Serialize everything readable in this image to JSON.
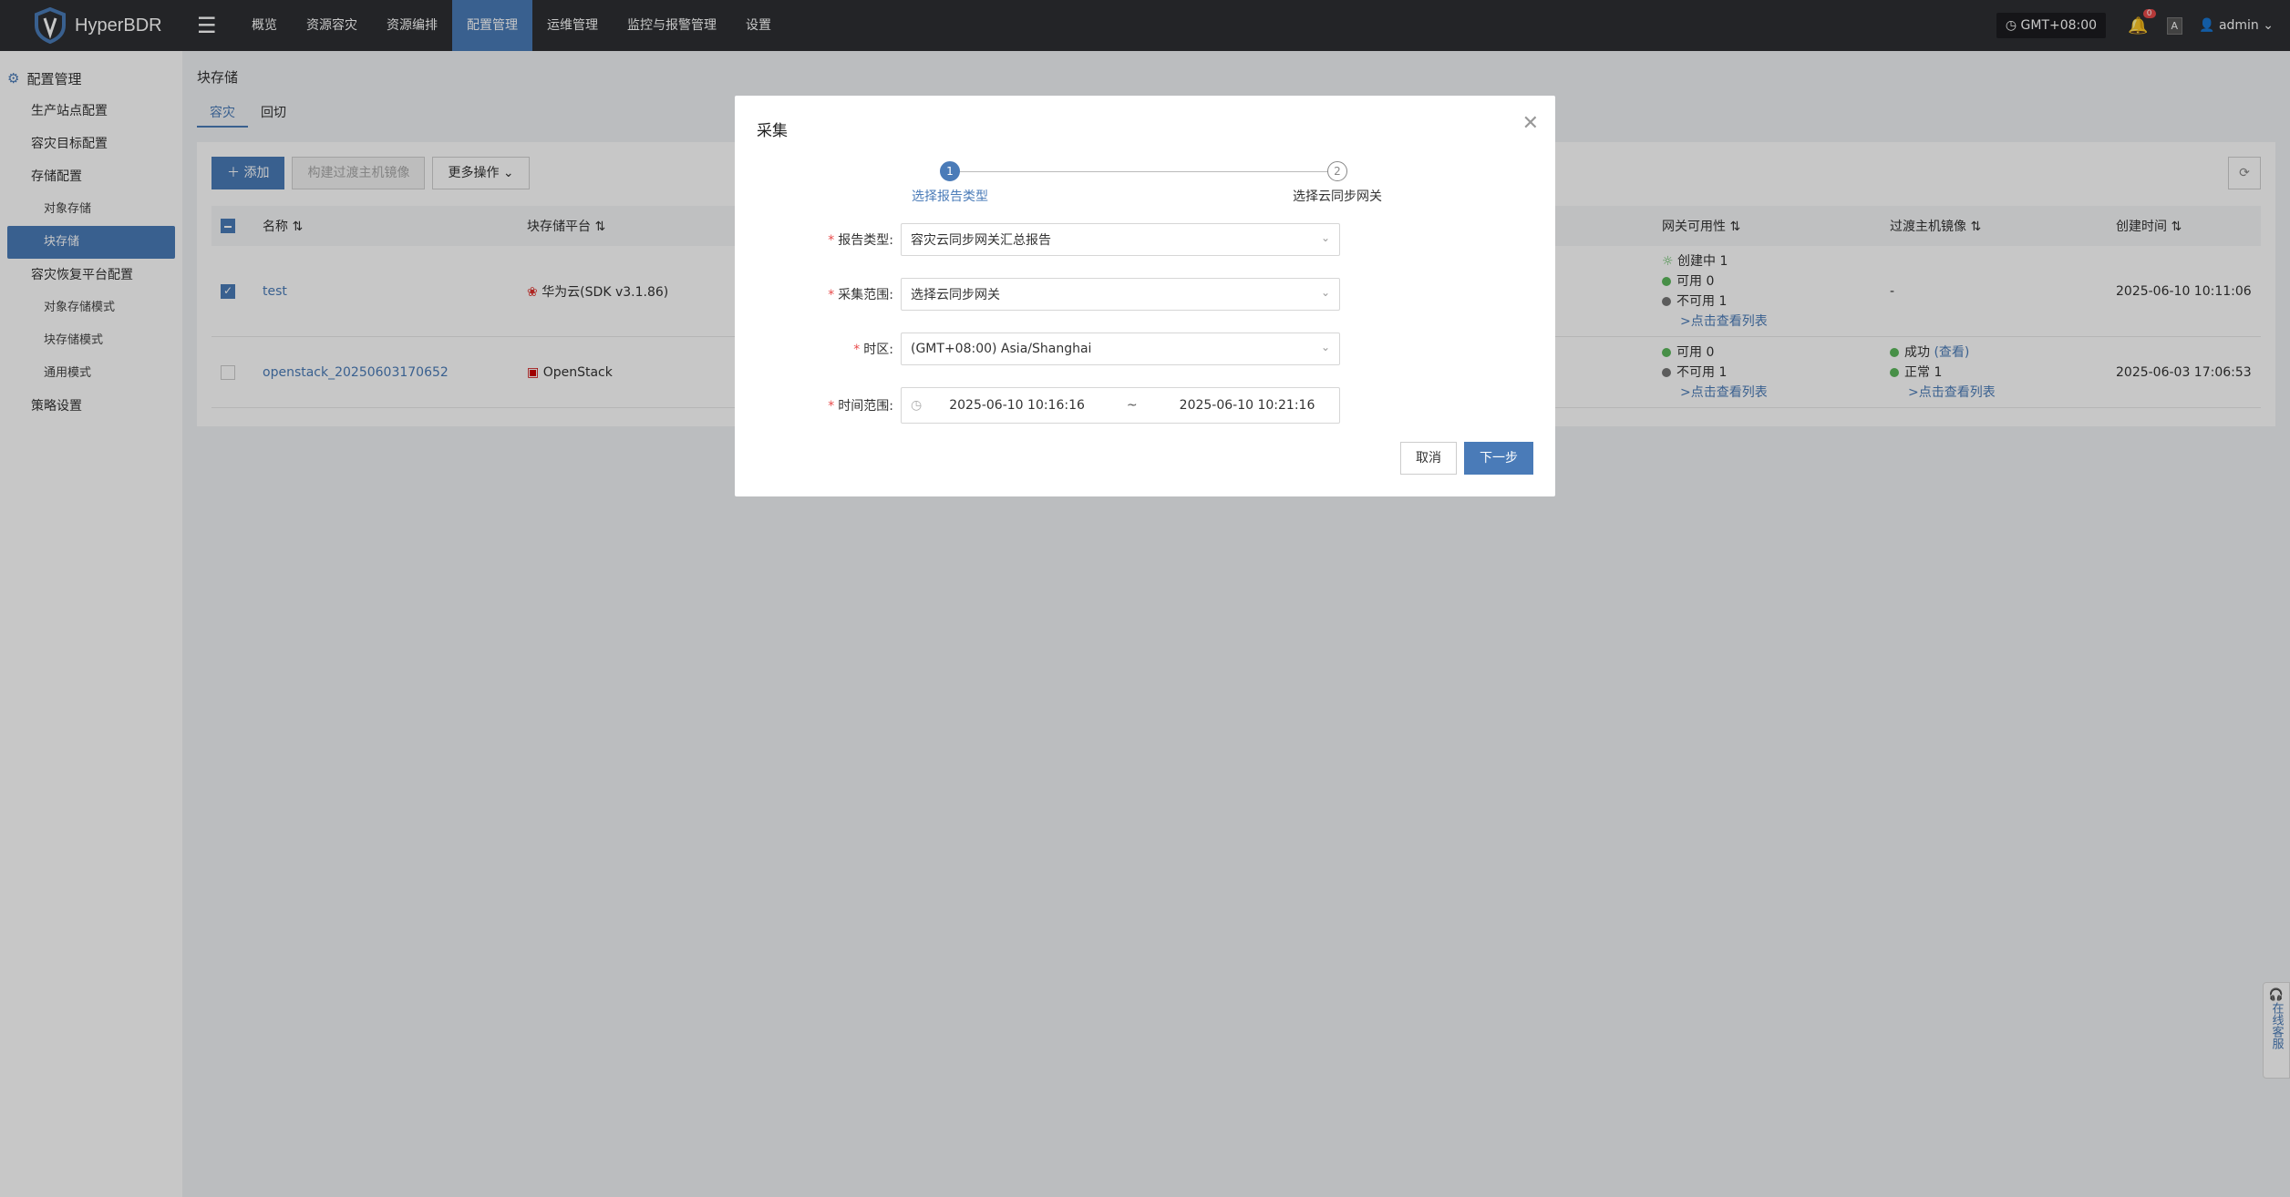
{
  "header": {
    "logo_text": "HyperBDR",
    "nav": [
      "概览",
      "资源容灾",
      "资源编排",
      "配置管理",
      "运维管理",
      "监控与报警管理",
      "设置"
    ],
    "active_nav": "配置管理",
    "timezone": "GMT+08:00",
    "notification_count": "0",
    "lang_icon": "A",
    "user": "admin"
  },
  "sidebar": {
    "title": "配置管理",
    "items": [
      "生产站点配置",
      "容灾目标配置",
      "存储配置",
      "对象存储",
      "块存储",
      "容灾恢复平台配置",
      "对象存储模式",
      "块存储模式",
      "通用模式",
      "策略设置"
    ],
    "active": "块存储"
  },
  "page": {
    "title": "块存储",
    "tabs": [
      "容灾",
      "回切"
    ],
    "toolbar": {
      "add": "添加",
      "build": "构建过渡主机镜像",
      "more": "更多操作"
    },
    "table": {
      "columns": [
        "名称",
        "块存储平台",
        "网关可用性",
        "过渡主机镜像",
        "创建时间"
      ],
      "rows": [
        {
          "name": "test",
          "platform": "华为云(SDK v3.1.86)",
          "gateway": [
            "创建中 1",
            "可用 0",
            "不可用 1"
          ],
          "gateway_link": ">点击查看列表",
          "image": "-",
          "image_link": "",
          "created": "2025-06-10 10:11:06",
          "checked": true
        },
        {
          "name": "openstack_20250603170652",
          "platform": "OpenStack",
          "gateway": [
            "可用 0",
            "不可用 1"
          ],
          "gateway_link": ">点击查看列表",
          "image": [
            "成功",
            "(查看)",
            "正常 1"
          ],
          "image_link": ">点击查看列表",
          "created": "2025-06-03 17:06:53",
          "checked": false
        }
      ]
    }
  },
  "modal": {
    "title": "采集",
    "steps": [
      {
        "num": "1",
        "label": "选择报告类型"
      },
      {
        "num": "2",
        "label": "选择云同步网关"
      }
    ],
    "fields": [
      {
        "label": "报告类型:",
        "value": "容灾云同步网关汇总报告"
      },
      {
        "label": "采集范围:",
        "value": "选择云同步网关"
      },
      {
        "label": "时区:",
        "value": "(GMT+08:00) Asia/Shanghai"
      },
      {
        "label": "时间范围:",
        "start": "2025-06-10 10:16:16",
        "sep": "~",
        "end": "2025-06-10 10:21:16"
      }
    ],
    "cancel": "取消",
    "next": "下一步"
  },
  "service": {
    "text": "在线客服"
  }
}
